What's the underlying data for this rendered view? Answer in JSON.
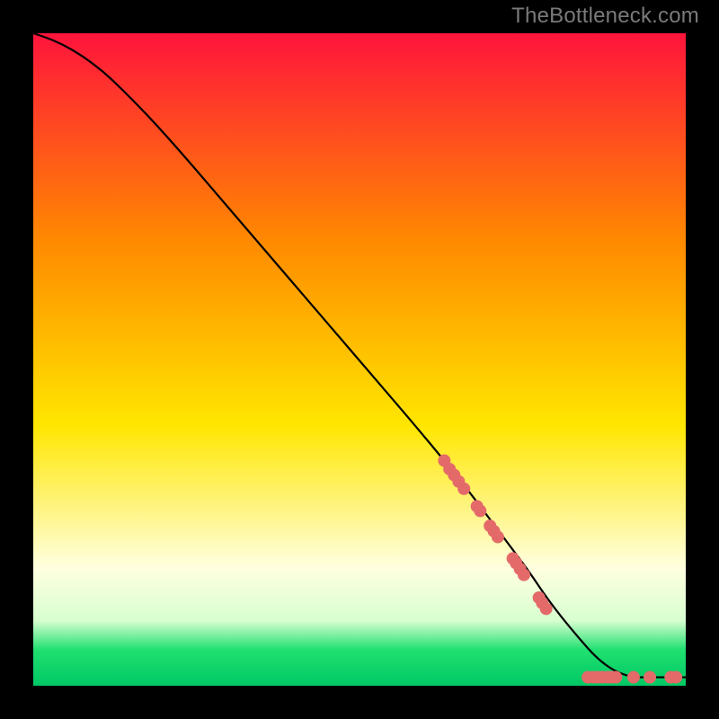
{
  "attribution": "TheBottleneck.com",
  "colors": {
    "bg": "#000000",
    "watermark": "#7a7a7a",
    "curve": "#000000",
    "points": "#e46a6a",
    "gradient": {
      "top": "#ff143c",
      "mid1": "#ff8a00",
      "mid2": "#ffe600",
      "pale": "#ffffe0",
      "green": "#20e070",
      "bottom": "#00c864"
    }
  },
  "chart_data": {
    "type": "line",
    "title": "",
    "xlabel": "",
    "ylabel": "",
    "xlim": [
      0,
      100
    ],
    "ylim": [
      0,
      100
    ],
    "series": [
      {
        "name": "curve",
        "x": [
          0,
          3,
          6,
          9,
          12,
          17,
          22,
          28,
          34,
          40,
          46,
          52,
          58,
          63,
          67,
          70,
          73,
          76,
          79,
          83,
          87,
          91,
          95,
          100
        ],
        "y": [
          100,
          99,
          97.5,
          95.5,
          93,
          88,
          82.5,
          75.5,
          68.5,
          61.5,
          54.5,
          47.5,
          40.5,
          34.5,
          29.5,
          25.5,
          21.5,
          17.5,
          13,
          8,
          3.5,
          1.3,
          1.3,
          1.3
        ]
      }
    ],
    "points_on_curve": [
      {
        "x": 63,
        "y": 34.5
      },
      {
        "x": 63.8,
        "y": 33.2
      },
      {
        "x": 64.5,
        "y": 32.3
      },
      {
        "x": 65.2,
        "y": 31.3
      },
      {
        "x": 66,
        "y": 30.2
      },
      {
        "x": 68,
        "y": 27.5
      },
      {
        "x": 68.5,
        "y": 26.8
      },
      {
        "x": 70,
        "y": 24.5
      },
      {
        "x": 70.6,
        "y": 23.7
      },
      {
        "x": 71.2,
        "y": 22.8
      },
      {
        "x": 73.5,
        "y": 19.5
      },
      {
        "x": 74,
        "y": 18.8
      },
      {
        "x": 74.6,
        "y": 17.9
      },
      {
        "x": 75.2,
        "y": 17
      },
      {
        "x": 77.5,
        "y": 13.5
      },
      {
        "x": 78,
        "y": 12.7
      },
      {
        "x": 78.6,
        "y": 11.8
      },
      {
        "x": 85,
        "y": 1.3
      },
      {
        "x": 85.8,
        "y": 1.3
      },
      {
        "x": 86.5,
        "y": 1.3
      },
      {
        "x": 87.2,
        "y": 1.3
      },
      {
        "x": 88,
        "y": 1.3
      },
      {
        "x": 88.6,
        "y": 1.3
      },
      {
        "x": 89.3,
        "y": 1.3
      },
      {
        "x": 92,
        "y": 1.3
      },
      {
        "x": 94.5,
        "y": 1.3
      },
      {
        "x": 97.7,
        "y": 1.3
      },
      {
        "x": 98.5,
        "y": 1.3
      }
    ]
  }
}
